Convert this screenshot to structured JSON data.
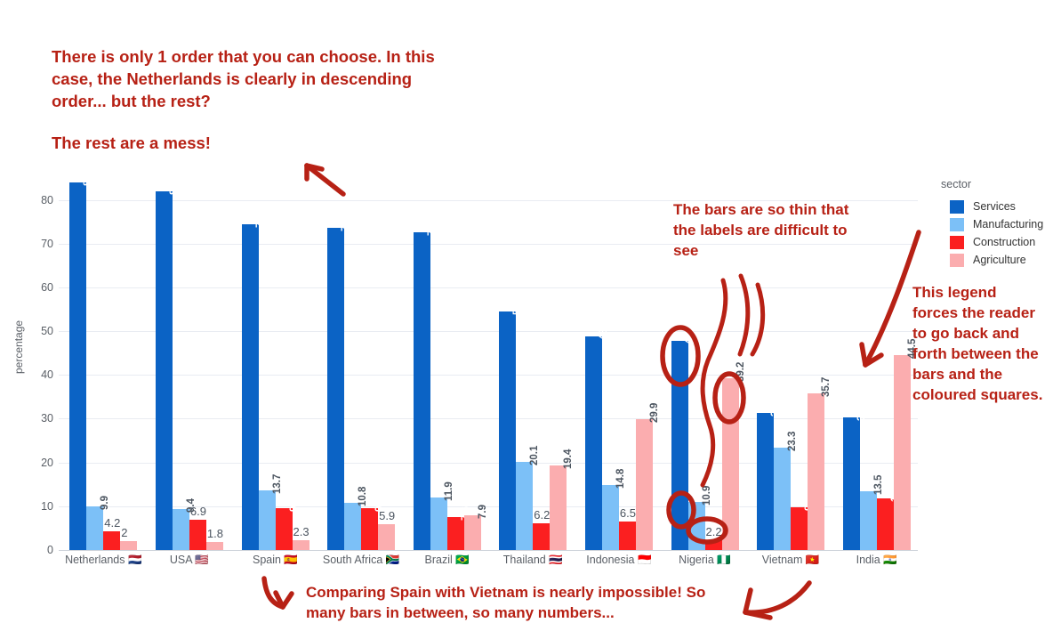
{
  "chart_data": {
    "type": "bar",
    "title": "",
    "xlabel": "",
    "ylabel": "percentage",
    "ylim": [
      0,
      85
    ],
    "yticks": [
      0,
      10,
      20,
      30,
      40,
      50,
      60,
      70,
      80
    ],
    "grid": true,
    "legend_title": "sector",
    "legend_position": "right",
    "categories": [
      "Netherlands 🇳🇱",
      "USA 🇺🇸",
      "Spain 🇪🇸",
      "South Africa 🇿🇦",
      "Brazil 🇧🇷",
      "Thailand 🇹🇭",
      "Indonesia 🇮🇩",
      "Nigeria 🇳🇬",
      "Vietnam 🇻🇳",
      "India 🇮🇳"
    ],
    "series": [
      {
        "name": "Services",
        "color": "#0b63c5",
        "values": [
          83.9,
          81.9,
          74.4,
          73.6,
          72.7,
          54.4,
          48.9,
          47.7,
          31.3,
          30.3
        ]
      },
      {
        "name": "Manufacturing",
        "color": "#7cc0f7",
        "values": [
          9.9,
          9.4,
          13.7,
          10.8,
          11.9,
          20.1,
          14.8,
          10.9,
          23.3,
          13.5
        ]
      },
      {
        "name": "Construction",
        "color": "#fb1f20",
        "values": [
          4.2,
          6.9,
          9.6,
          9.6,
          7.6,
          6.2,
          6.5,
          2.2,
          9.7,
          11.8
        ]
      },
      {
        "name": "Agriculture",
        "color": "#fbadaf",
        "values": [
          2,
          1.8,
          2.3,
          5.9,
          7.9,
          19.4,
          29.9,
          39.2,
          35.7,
          44.5
        ]
      }
    ],
    "labels": [
      [
        "83.9",
        "9.9",
        "4.2",
        "2"
      ],
      [
        "81.9",
        "9.4",
        "6.9",
        "1.8"
      ],
      [
        "74.4",
        "13.7",
        "9.6",
        "2.3"
      ],
      [
        "73.6",
        "10.8",
        "9.6",
        "5.9"
      ],
      [
        "72.7",
        "11.9",
        "7.6",
        "7.9"
      ],
      [
        "54.4",
        "20.1",
        "6.2",
        "19.4"
      ],
      [
        "48.9",
        "14.8",
        "6.5",
        "29.9"
      ],
      [
        "47.7",
        "10.9",
        "2.2",
        "39.2"
      ],
      [
        "31.3",
        "23.3",
        "9.7",
        "35.7"
      ],
      [
        "30.3",
        "13.5",
        "11.8",
        "44.5"
      ]
    ]
  },
  "legend": {
    "title": "sector",
    "items": [
      {
        "label": "Services",
        "color": "#0b63c5"
      },
      {
        "label": "Manufacturing",
        "color": "#7cc0f7"
      },
      {
        "label": "Construction",
        "color": "#fb1f20"
      },
      {
        "label": "Agriculture",
        "color": "#fbadaf"
      }
    ]
  },
  "annotations": {
    "color": "#b72115",
    "intro": "There is only 1 order that you can choose. In this case, the Netherlands is clearly in descending order... but the rest?",
    "mess": "The rest are a mess!",
    "thin_bars": "The bars are so thin that the labels are difficult to see",
    "legend_note": "This legend forces the reader to go back and forth between the bars and the coloured squares.",
    "compare": "Comparing Spain with Vietnam is nearly impossible! So many bars in between, so many numbers..."
  }
}
